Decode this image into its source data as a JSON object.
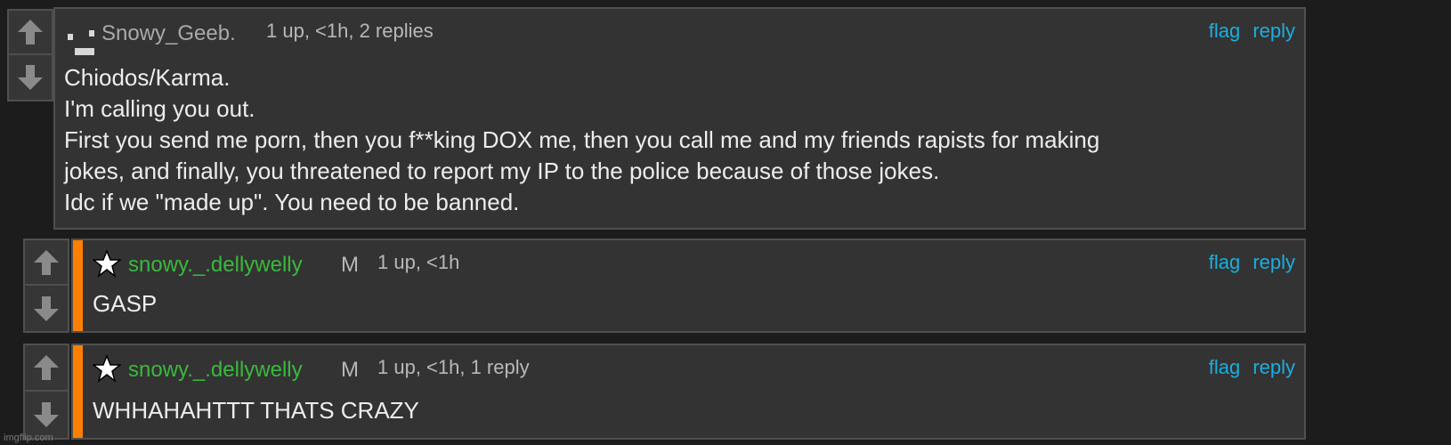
{
  "comments": [
    {
      "username": "Snowy_Geeb.",
      "username_color": "#a9a9a9",
      "meta": "1 up, <1h, 2 replies",
      "flag": "flag",
      "reply": "reply",
      "body": "Chiodos/Karma.\nI'm calling you out.\nFirst you send me porn, then you f**king DOX me, then you call me and my friends rapists for making\njokes, and finally, you threatened to report my IP to the police because of those jokes.\nIdc if we \"made up\". You need to be banned."
    },
    {
      "username": "snowy._.dellywelly",
      "username_color": "#39b93c",
      "badge": "M",
      "meta": "1 up, <1h",
      "flag": "flag",
      "reply": "reply",
      "body": "GASP"
    },
    {
      "username": "snowy._.dellywelly",
      "username_color": "#39b93c",
      "badge": "M",
      "meta": "1 up, <1h, 1 reply",
      "flag": "flag",
      "reply": "reply",
      "body": "WHHAHAHTTT THATS CRAZY"
    }
  ],
  "colors": {
    "link": "#1aaee0",
    "mod_stripe": "#ff7f00",
    "panel": "#333333",
    "background": "#1c1c1c"
  },
  "icons": {
    "upvote": "up-arrow-icon",
    "downvote": "down-arrow-icon",
    "mod_star": "star-icon",
    "avatar": "pixel-avatar-icon"
  },
  "watermark": "imgflip.com"
}
